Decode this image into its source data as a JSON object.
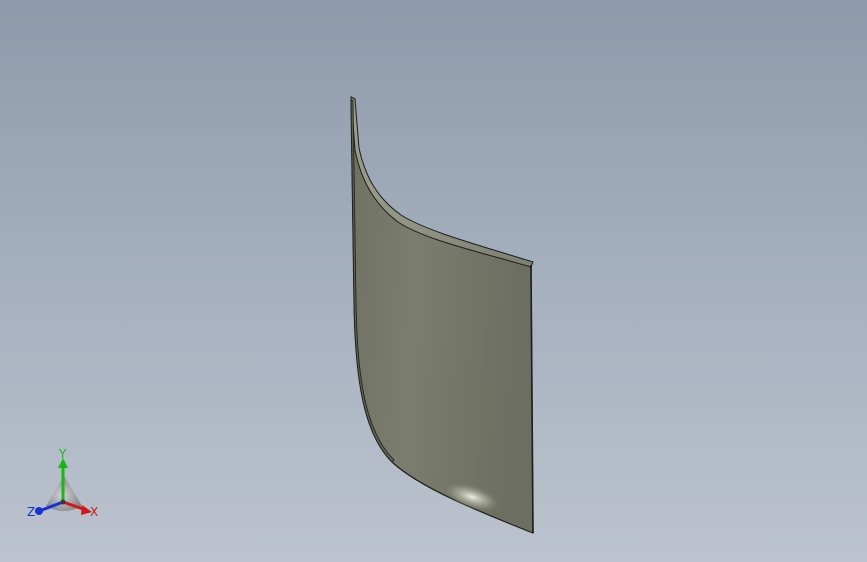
{
  "viewport": {
    "background_top": "#8e9aab",
    "background_bottom": "#bcc3ce"
  },
  "model": {
    "name": "curved-sheet-surface",
    "face_color": "#75776a",
    "edge_color": "#1e1e1a"
  },
  "triad": {
    "x_label": "X",
    "y_label": "Y",
    "z_label": "Z",
    "x_color": "#d01818",
    "y_color": "#18b818",
    "z_color": "#1830d8"
  }
}
